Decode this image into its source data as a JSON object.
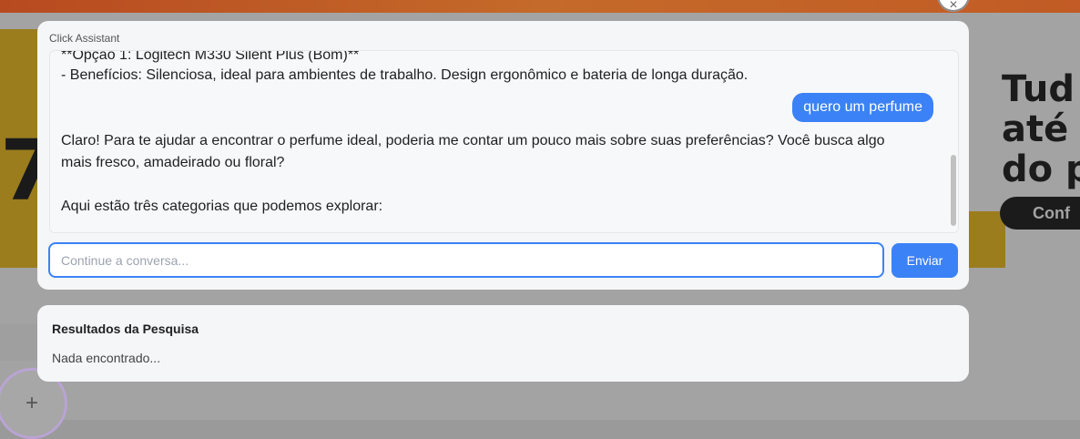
{
  "background": {
    "headline": "Tud\naté\ndo p",
    "pill_label": "Conf",
    "big_glyph": "7"
  },
  "close_button": {
    "icon": "close-icon",
    "symbol": "×"
  },
  "assistant": {
    "title": "Click Assistant",
    "messages": {
      "cut_line": "**Opção 1: Logitech M330 Silent Plus (Bom)**",
      "benefits_line": "- Benefícios: Silenciosa, ideal para ambientes de trabalho. Design ergonômico e bateria de longa duração.",
      "user_message": "quero um perfume",
      "reply": "Claro! Para te ajudar a encontrar o perfume ideal, poderia me contar um pouco mais sobre suas preferências? Você busca algo mais fresco, amadeirado ou floral?",
      "categories_intro": "Aqui estão três categorias que podemos explorar:"
    },
    "input": {
      "placeholder": "Continue a conversa...",
      "value": ""
    },
    "send_label": "Enviar"
  },
  "results": {
    "title": "Resultados da Pesquisa",
    "empty_text": "Nada encontrado..."
  },
  "colors": {
    "accent": "#3b82f6",
    "panel_bg": "#f5f6f8",
    "overlay_bg": "#a3a3a3"
  }
}
